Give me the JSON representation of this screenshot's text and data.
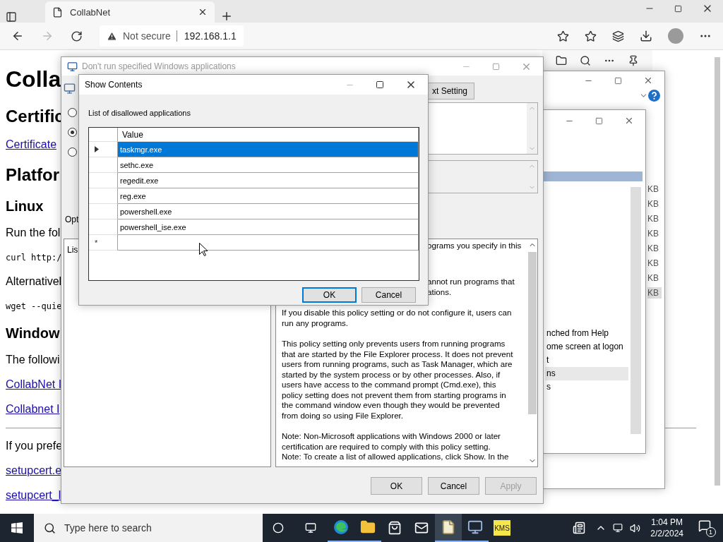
{
  "browser": {
    "tab_title": "CollabNet",
    "security_label": "Not secure",
    "address": "192.168.1.1"
  },
  "page": {
    "items": [
      {
        "kind": "h1",
        "text": "Colla"
      },
      {
        "kind": "h2",
        "text": "Certific"
      },
      {
        "kind": "link",
        "text": "Certificate"
      },
      {
        "kind": "h2",
        "text": "Platfor"
      },
      {
        "kind": "h3",
        "text": "Linux"
      },
      {
        "kind": "p",
        "text": "Run the fol"
      },
      {
        "kind": "code",
        "text": "curl http:/"
      },
      {
        "kind": "p",
        "text": "Alternativel"
      },
      {
        "kind": "code",
        "text": "wget --quie"
      },
      {
        "kind": "h3",
        "text": "Window"
      },
      {
        "kind": "p",
        "text": "The followi"
      },
      {
        "kind": "link",
        "text": "CollabNet I"
      },
      {
        "kind": "link",
        "text": "Collabnet I"
      },
      {
        "kind": "rule"
      },
      {
        "kind": "p",
        "text": "If you prefe"
      },
      {
        "kind": "link",
        "text": "setupcert.e"
      },
      {
        "kind": "link",
        "text": "setupcert_l"
      }
    ]
  },
  "back_windows": {
    "sizes": [
      "KB",
      "KB",
      "KB",
      "KB",
      "KB",
      "KB",
      "KB",
      "KB"
    ],
    "entries": [
      {
        "text": "nched from Help",
        "selected": false
      },
      {
        "text": "ome screen at logon",
        "selected": false
      },
      {
        "text": "t",
        "selected": false
      },
      {
        "text": "ns",
        "selected": true
      },
      {
        "text": "s",
        "selected": false
      }
    ]
  },
  "policy_window": {
    "title": "Don't run specified Windows applications",
    "setting_button": "xt Setting",
    "radios": [
      {
        "selected": false
      },
      {
        "selected": true
      },
      {
        "selected": false
      }
    ],
    "options_label": "Opt",
    "list_label": "Lis",
    "help": [
      {
        "cut": true,
        "lines": [
          "ograms you specify in this"
        ]
      },
      {
        "cut": true,
        "lines": [
          "annot run programs that",
          "ations."
        ]
      },
      {
        "cut": false,
        "lines": [
          "If you disable this policy setting or do not configure it, users can",
          "run any programs."
        ]
      },
      {
        "cut": false,
        "lines": [
          "This policy setting only prevents users from running programs",
          "that are started by the File Explorer process. It does not prevent",
          "users from running programs, such as Task Manager, which are",
          "started by the system process or by other processes.  Also, if",
          "users have access to the command prompt (Cmd.exe), this",
          "policy setting does not prevent them from starting programs in",
          "the command window even though they would be prevented",
          "from doing so using File Explorer."
        ]
      },
      {
        "cut": false,
        "lines": [
          "Note: Non-Microsoft applications with Windows 2000 or later",
          "certification are required to comply with this policy setting.",
          "Note: To create a list of allowed applications, click Show.  In the"
        ]
      }
    ],
    "buttons": [
      {
        "label": "OK",
        "disabled": false
      },
      {
        "label": "Cancel",
        "disabled": false
      },
      {
        "label": "Apply",
        "disabled": true
      }
    ]
  },
  "show_contents": {
    "title": "Show Contents",
    "label": "List of disallowed applications",
    "column": "Value",
    "rows": [
      {
        "value": "taskmgr.exe",
        "selected": true
      },
      {
        "value": "sethc.exe",
        "selected": false
      },
      {
        "value": "regedit.exe",
        "selected": false
      },
      {
        "value": "reg.exe",
        "selected": false
      },
      {
        "value": "powershell.exe",
        "selected": false
      },
      {
        "value": "powershell_ise.exe",
        "selected": false
      }
    ],
    "new_row_marker": "*",
    "buttons": [
      {
        "label": "OK",
        "default": true
      },
      {
        "label": "Cancel",
        "default": false
      }
    ]
  },
  "taskbar": {
    "search_placeholder": "Type here to search",
    "kms_label": "KMS",
    "time": "1:04 PM",
    "date": "2/2/2024",
    "notification_count": "1"
  }
}
